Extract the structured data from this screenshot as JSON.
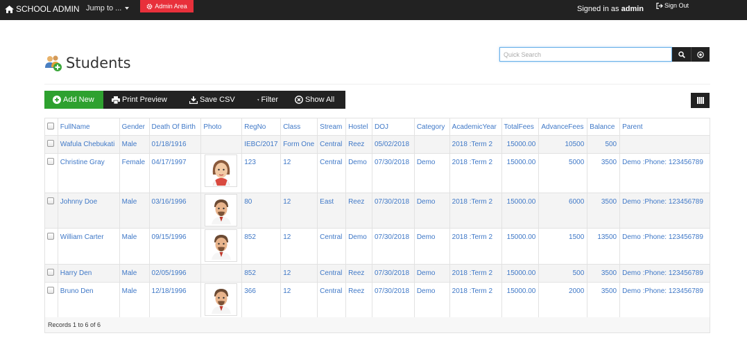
{
  "navbar": {
    "brand": "SCHOOL ADMIN",
    "jump_to": "Jump to ...",
    "admin_area": "Admin Area",
    "signed_in_prefix": "Signed in as",
    "signed_in_user": "admin",
    "sign_out": "Sign Out"
  },
  "page": {
    "title": "Students"
  },
  "search": {
    "placeholder": "Quick Search",
    "value": ""
  },
  "toolbar": {
    "add_new": "Add New",
    "print_preview": "Print Preview",
    "save_csv": "Save CSV",
    "filter": "Filter",
    "show_all": "Show All"
  },
  "colors": {
    "navbar_bg": "#222222",
    "admin_area": "#e8303b",
    "add_new": "#2ea12f",
    "link": "#3f78c7"
  },
  "table": {
    "headers": [
      "FullName",
      "Gender",
      "Death Of Birth",
      "Photo",
      "RegNo",
      "Class",
      "Stream",
      "Hostel",
      "DOJ",
      "Category",
      "AcademicYear",
      "TotalFees",
      "AdvanceFees",
      "Balance",
      "Parent"
    ],
    "rows": [
      {
        "name": "Wafula Chebukati",
        "gender": "Male",
        "dob": "01/18/1916",
        "photo": "",
        "regno": "IEBC/2017",
        "class": "Form One",
        "stream": "Central",
        "hostel": "Reez",
        "doj": "05/02/2018",
        "category": "",
        "year": "2018 :Term 2",
        "total": "15000.00",
        "advance": "10500",
        "balance": "500",
        "parent": ""
      },
      {
        "name": "Christine Gray",
        "gender": "Female",
        "dob": "04/17/1997",
        "photo": "female-avatar",
        "regno": "123",
        "class": "12",
        "stream": "Central",
        "hostel": "Demo",
        "doj": "07/30/2018",
        "category": "Demo",
        "year": "2018 :Term 2",
        "total": "15000.00",
        "advance": "5000",
        "balance": "3500",
        "parent": "Demo :Phone: 123456789"
      },
      {
        "name": "Johnny Doe",
        "gender": "Male",
        "dob": "03/16/1996",
        "photo": "male-avatar",
        "regno": "80",
        "class": "12",
        "stream": "East",
        "hostel": "Reez",
        "doj": "07/30/2018",
        "category": "Demo",
        "year": "2018 :Term 2",
        "total": "15000.00",
        "advance": "6000",
        "balance": "3500",
        "parent": "Demo :Phone: 123456789"
      },
      {
        "name": "William Carter",
        "gender": "Male",
        "dob": "09/15/1996",
        "photo": "male-avatar",
        "regno": "852",
        "class": "12",
        "stream": "Central",
        "hostel": "Demo",
        "doj": "07/30/2018",
        "category": "Demo",
        "year": "2018 :Term 2",
        "total": "15000.00",
        "advance": "1500",
        "balance": "13500",
        "parent": "Demo :Phone: 123456789"
      },
      {
        "name": "Harry Den",
        "gender": "Male",
        "dob": "02/05/1996",
        "photo": "",
        "regno": "852",
        "class": "12",
        "stream": "Central",
        "hostel": "Reez",
        "doj": "07/30/2018",
        "category": "Demo",
        "year": "2018 :Term 2",
        "total": "15000.00",
        "advance": "500",
        "balance": "3500",
        "parent": "Demo :Phone: 123456789"
      },
      {
        "name": "Bruno Den",
        "gender": "Male",
        "dob": "12/18/1996",
        "photo": "male-avatar",
        "regno": "366",
        "class": "12",
        "stream": "Central",
        "hostel": "Reez",
        "doj": "07/30/2018",
        "category": "Demo",
        "year": "2018 :Term 2",
        "total": "15000.00",
        "advance": "2000",
        "balance": "3500",
        "parent": "Demo :Phone: 123456789"
      }
    ]
  },
  "footer": {
    "records": "Records 1 to 6 of 6"
  }
}
